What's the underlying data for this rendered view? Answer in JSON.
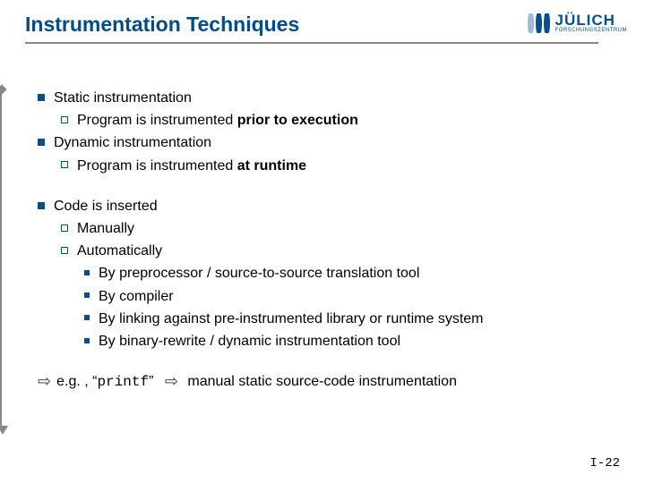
{
  "title": "Instrumentation Techniques",
  "logo": {
    "name": "JÜLICH",
    "sub": "FORSCHUNGSZENTRUM"
  },
  "content": {
    "static_title": "Static instrumentation",
    "static_sub_pre": "Program is instrumented ",
    "static_sub_em": "prior to execution",
    "dynamic_title": "Dynamic instrumentation",
    "dynamic_sub_pre": "Program is instrumented ",
    "dynamic_sub_em": "at runtime",
    "code_title": "Code is inserted",
    "manually": "Manually",
    "automatically": "Automatically",
    "auto1": "By preprocessor / source-to-source translation tool",
    "auto2": "By compiler",
    "auto3": "By linking against pre-instrumented library or runtime system",
    "auto4": "By binary-rewrite / dynamic instrumentation tool"
  },
  "final": {
    "eg": "e.g. , “",
    "code": "printf",
    "close": "”",
    "after": "  manual static source-code instrumentation"
  },
  "page": "I-22"
}
